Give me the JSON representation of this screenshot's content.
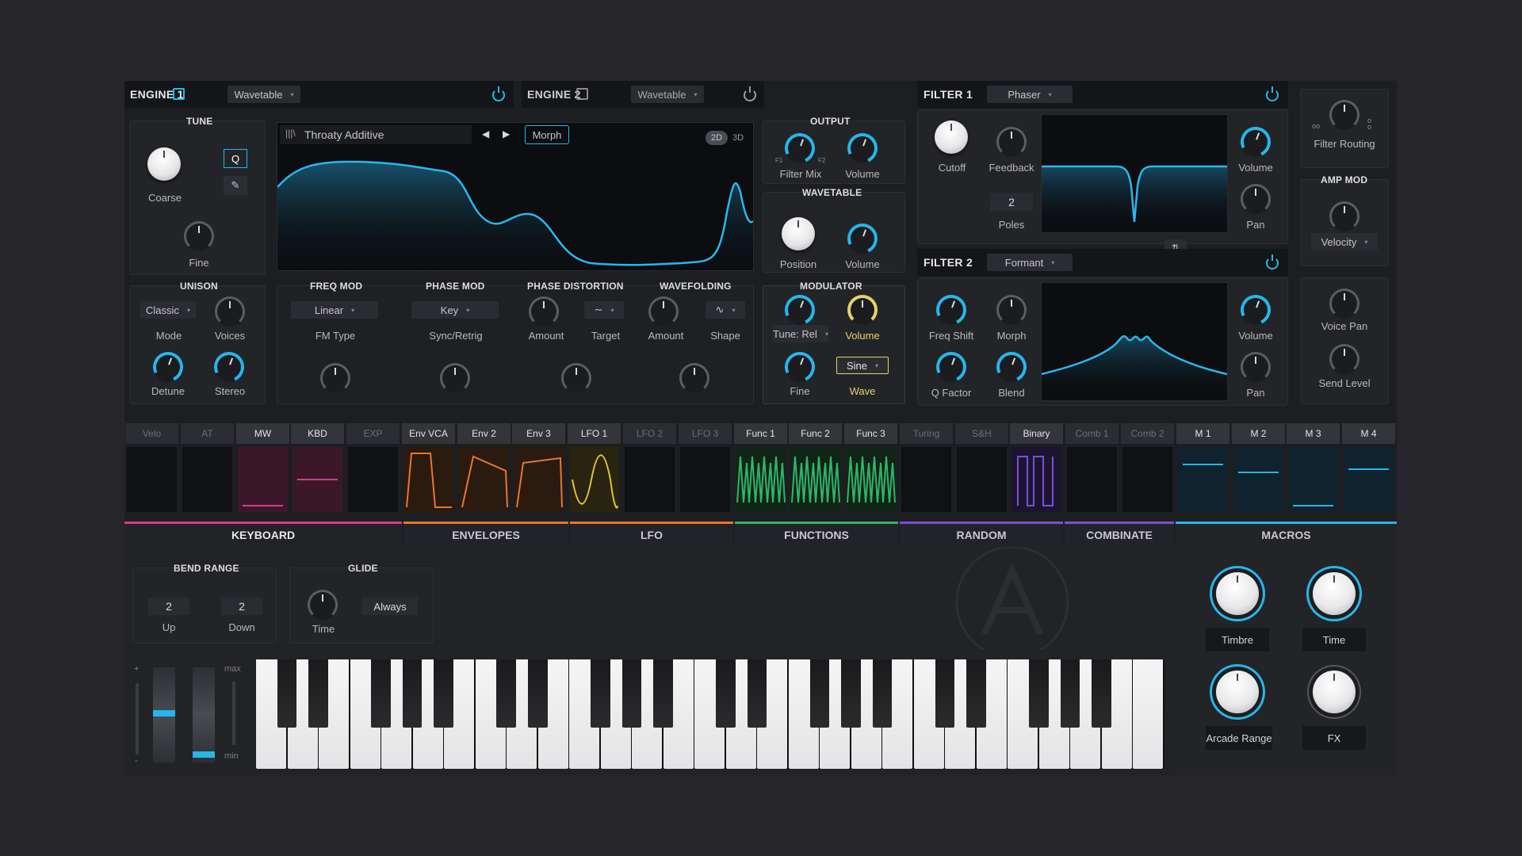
{
  "engine1": {
    "title": "ENGINE 1",
    "type": "Wavetable"
  },
  "engine2": {
    "title": "ENGINE 2",
    "type": "Wavetable"
  },
  "tune": {
    "title": "TUNE",
    "coarse": "Coarse",
    "fine": "Fine",
    "q": "Q"
  },
  "wavetable_display": {
    "name": "Throaty Additive",
    "morph": "Morph",
    "mode_2d": "2D",
    "mode_3d": "3D"
  },
  "output": {
    "title": "OUTPUT",
    "filter_mix": "Filter Mix",
    "volume": "Volume",
    "f1": "F1",
    "f2": "F2"
  },
  "wavetable": {
    "title": "WAVETABLE",
    "position": "Position",
    "volume": "Volume"
  },
  "unison": {
    "title": "UNISON",
    "mode_value": "Classic",
    "mode": "Mode",
    "voices": "Voices",
    "detune": "Detune",
    "stereo": "Stereo"
  },
  "freq_mod": {
    "title": "FREQ MOD",
    "value": "Linear",
    "label": "FM Type"
  },
  "phase_mod": {
    "title": "PHASE MOD",
    "value": "Key",
    "label": "Sync/Retrig"
  },
  "phase_distortion": {
    "title": "PHASE DISTORTION",
    "amount": "Amount",
    "target": "Target"
  },
  "wavefolding": {
    "title": "WAVEFOLDING",
    "amount": "Amount",
    "shape": "Shape"
  },
  "modulator": {
    "title": "MODULATOR",
    "tune_value": "Tune: Rel",
    "volume": "Volume",
    "fine": "Fine",
    "wave_value": "Sine",
    "wave": "Wave"
  },
  "filter1": {
    "title": "FILTER 1",
    "type": "Phaser",
    "cutoff": "Cutoff",
    "feedback": "Feedback",
    "poles_value": "2",
    "poles": "Poles",
    "volume": "Volume",
    "pan": "Pan"
  },
  "filter2": {
    "title": "FILTER 2",
    "type": "Formant",
    "freq_shift": "Freq Shift",
    "morph": "Morph",
    "q_factor": "Q Factor",
    "blend": "Blend",
    "volume": "Volume",
    "pan": "Pan"
  },
  "right_col": {
    "filter_routing": "Filter Routing",
    "amp_mod": "AMP MOD",
    "velocity": "Velocity",
    "voice_pan": "Voice Pan",
    "send_level": "Send Level"
  },
  "mod_sources": [
    "Velo",
    "AT",
    "MW",
    "KBD",
    "EXP",
    "Env VCA",
    "Env 2",
    "Env 3",
    "LFO 1",
    "LFO 2",
    "LFO 3",
    "Func 1",
    "Func 2",
    "Func 3",
    "Turing",
    "S&H",
    "Binary",
    "Comb 1",
    "Comb 2",
    "M 1",
    "M 2",
    "M 3",
    "M 4"
  ],
  "bottom_tabs": [
    "KEYBOARD",
    "ENVELOPES",
    "LFO",
    "FUNCTIONS",
    "RANDOM",
    "COMBINATE"
  ],
  "macros": {
    "title": "MACROS",
    "timbre": "Timbre",
    "time": "Time",
    "arcade_range": "Arcade Range",
    "fx": "FX"
  },
  "bend_range": {
    "title": "BEND RANGE",
    "up_value": "2",
    "down_value": "2",
    "up": "Up",
    "down": "Down"
  },
  "glide": {
    "title": "GLIDE",
    "mode": "Always",
    "time": "Time"
  },
  "wheels": {
    "max": "max",
    "min": "min",
    "plus": "+",
    "minus": "-"
  },
  "colors": {
    "accent": "#26b6ea",
    "envelope": "#e7772d",
    "lfo": "#e0c238",
    "function": "#2fb569",
    "random": "#7a4fd8",
    "keyboard": "#d93a8a"
  }
}
